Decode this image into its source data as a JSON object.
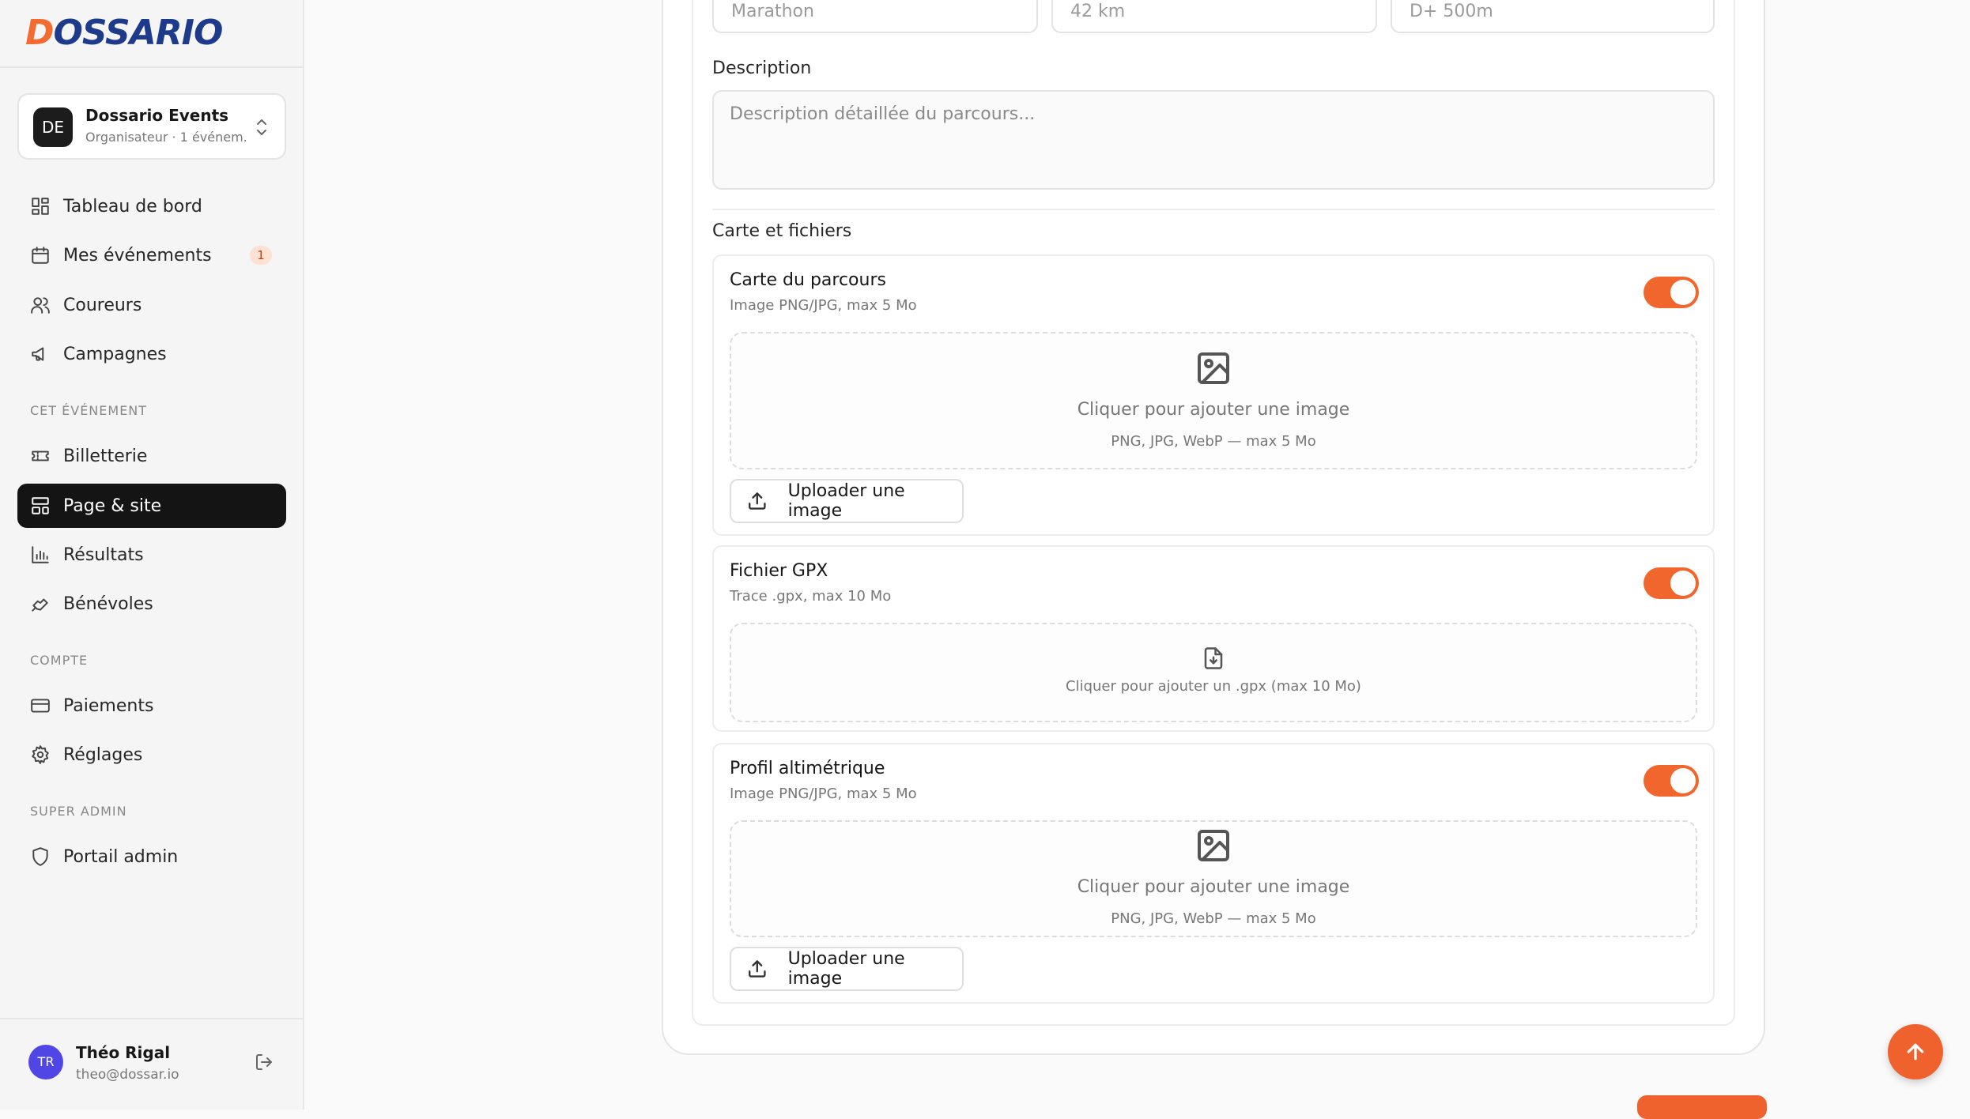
{
  "sidebar": {
    "logo_text": "DOSSARIO",
    "org": {
      "initials": "DE",
      "name": "Dossario Events",
      "subtitle": "Organisateur · 1 événem..."
    },
    "nav_main": [
      {
        "label": "Tableau de bord",
        "icon": "dashboard-icon"
      },
      {
        "label": "Mes événements",
        "icon": "calendar-icon",
        "badge": "1"
      },
      {
        "label": "Coureurs",
        "icon": "users-icon"
      },
      {
        "label": "Campagnes",
        "icon": "megaphone-icon"
      }
    ],
    "section_event": "CET ÉVÉNEMENT",
    "nav_event": [
      {
        "label": "Billetterie",
        "icon": "ticket-icon"
      },
      {
        "label": "Page & site",
        "icon": "layout-icon",
        "active": true
      },
      {
        "label": "Résultats",
        "icon": "bar-chart-icon"
      },
      {
        "label": "Bénévoles",
        "icon": "handshake-icon"
      }
    ],
    "section_account": "COMPTE",
    "nav_account": [
      {
        "label": "Paiements",
        "icon": "credit-card-icon"
      },
      {
        "label": "Réglages",
        "icon": "settings-icon"
      }
    ],
    "section_super": "SUPER ADMIN",
    "nav_super": [
      {
        "label": "Portail admin",
        "icon": "shield-icon"
      }
    ],
    "user": {
      "initials": "TR",
      "name": "Théo Rigal",
      "email": "theo@dossar.io"
    }
  },
  "form": {
    "inputs_top": [
      {
        "placeholder": "Marathon"
      },
      {
        "placeholder": "42 km"
      },
      {
        "placeholder": "D+ 500m"
      }
    ],
    "description_label": "Description",
    "description_placeholder": "Description détaillée du parcours...",
    "files_section_label": "Carte et fichiers",
    "cards": {
      "map": {
        "title": "Carte du parcours",
        "hint": "Image PNG/JPG, max 5 Mo",
        "enabled": true,
        "drop_text": "Cliquer pour ajouter une image",
        "drop_hint": "PNG, JPG, WebP — max 5 Mo",
        "upload_label": "Uploader une image"
      },
      "gpx": {
        "title": "Fichier GPX",
        "hint": "Trace .gpx, max 10 Mo",
        "enabled": true,
        "drop_text": "Cliquer pour ajouter un .gpx (max 10 Mo)"
      },
      "profile": {
        "title": "Profil altimétrique",
        "hint": "Image PNG/JPG, max 5 Mo",
        "enabled": true,
        "drop_text": "Cliquer pour ajouter une image",
        "drop_hint": "PNG, JPG, WebP — max 5 Mo",
        "upload_label": "Uploader une image"
      }
    }
  },
  "colors": {
    "accent": "#f0622d",
    "active_nav": "#141414",
    "logo_blue": "#1e3a8a"
  }
}
